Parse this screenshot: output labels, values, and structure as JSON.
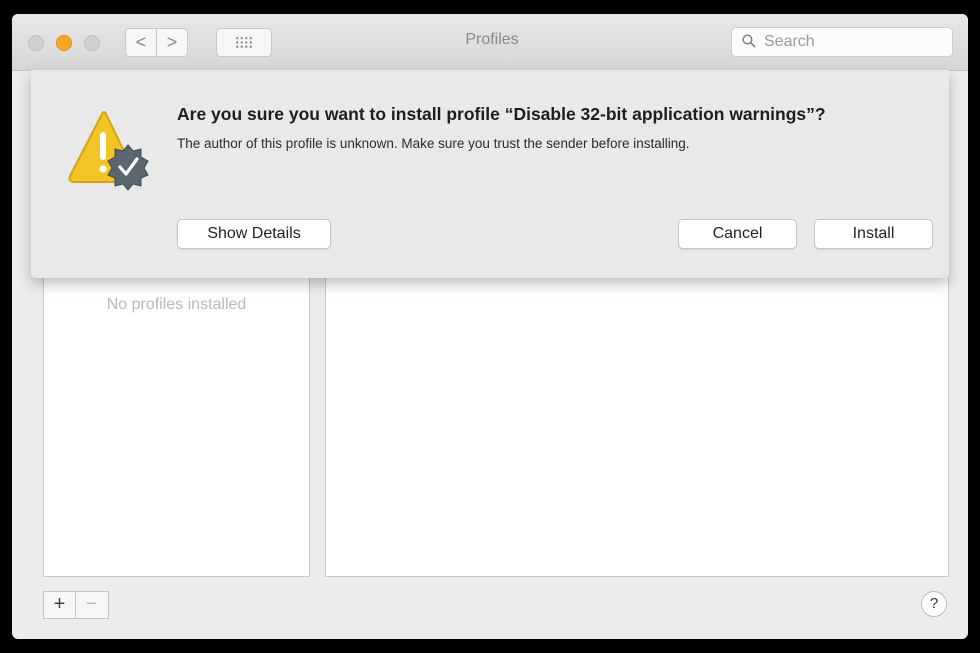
{
  "window": {
    "title": "Profiles",
    "search_placeholder": "Search",
    "nav_back": "<",
    "nav_forward": ">"
  },
  "dialog": {
    "heading": "Are you sure you want to install profile “Disable 32-bit application warnings”?",
    "message": "The author of this profile is unknown. Make sure you trust the sender before installing.",
    "show_details": "Show Details",
    "cancel": "Cancel",
    "install": "Install",
    "icon": "warning-badge-icon"
  },
  "profiles": {
    "empty_text": "No profiles installed",
    "add": "+",
    "remove": "−"
  },
  "help": "?",
  "colors": {
    "minimize": "#f5a524",
    "warning": "#f3c425",
    "badge": "#5a6670"
  }
}
